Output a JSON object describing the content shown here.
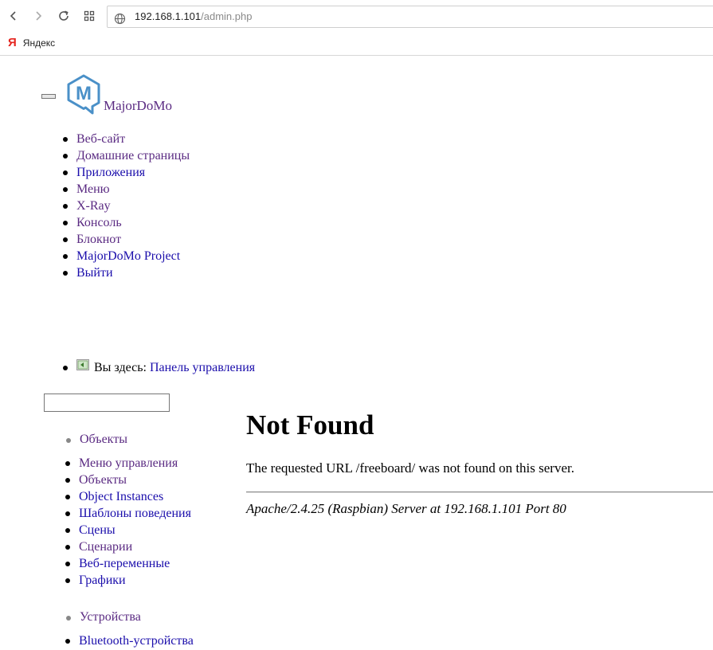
{
  "browser": {
    "address": {
      "host": "192.168.1.101",
      "path": "/admin.php"
    },
    "bookmarks": [
      {
        "label": "Яндекс"
      }
    ]
  },
  "page": {
    "brand": {
      "name": "MajorDoMo",
      "logo_letter": "M",
      "logo_color": "#4a90c8"
    },
    "main_nav": [
      {
        "label": "Веб-сайт"
      },
      {
        "label": "Домашние страницы"
      },
      {
        "label": "Приложения"
      },
      {
        "label": "Меню"
      },
      {
        "label": "X-Ray"
      },
      {
        "label": "Консоль"
      },
      {
        "label": "Блокнот"
      },
      {
        "label": "MajorDoMo Project"
      },
      {
        "label": "Выйти"
      }
    ],
    "breadcrumb": {
      "prefix": "Вы здесь:",
      "link": "Панель управления"
    },
    "search": {
      "value": "",
      "placeholder": ""
    },
    "sections": [
      {
        "title": "Объекты",
        "items": [
          {
            "label": "Меню управления"
          },
          {
            "label": "Объекты"
          },
          {
            "label": "Object Instances"
          },
          {
            "label": "Шаблоны поведения"
          },
          {
            "label": "Сцены"
          },
          {
            "label": "Сценарии"
          },
          {
            "label": "Веб-переменные"
          },
          {
            "label": "Графики"
          }
        ]
      },
      {
        "title": "Устройства",
        "items": [
          {
            "label": "Bluetooth-устройства"
          }
        ]
      }
    ],
    "error": {
      "title": "Not Found",
      "message": "The requested URL /freeboard/ was not found on this server.",
      "signature": "Apache/2.4.25 (Raspbian) Server at 192.168.1.101 Port 80"
    }
  }
}
